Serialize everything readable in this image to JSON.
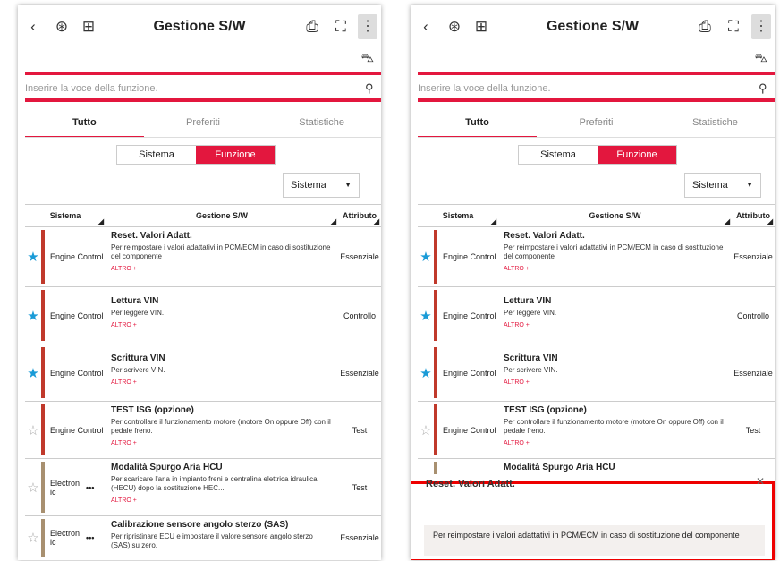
{
  "app": {
    "title": "Gestione S/W",
    "search_placeholder": "Inserire la voce della funzione.",
    "tabs": [
      "Tutto",
      "Preferiti",
      "Statistiche"
    ],
    "segment": [
      "Sistema",
      "Funzione"
    ],
    "sort_select": "Sistema",
    "columns": [
      "Sistema",
      "Gestione S/W",
      "Attributo"
    ],
    "more_label": "ALTRO +",
    "accent_color": "#e3173e",
    "favorite_color": "#1a9bd7"
  },
  "rows": [
    {
      "favorite": true,
      "system": "Engine Control",
      "title": "Reset. Valori Adatt.",
      "desc": "Per reimpostare i valori adattativi in PCM/ECM in caso di sostituzione del componente",
      "attr": "Essenziale"
    },
    {
      "favorite": true,
      "system": "Engine Control",
      "title": "Lettura VIN",
      "desc": "Per leggere VIN.",
      "attr": "Controllo"
    },
    {
      "favorite": true,
      "system": "Engine Control",
      "title": "Scrittura VIN",
      "desc": "Per scrivere VIN.",
      "attr": "Essenziale"
    },
    {
      "favorite": false,
      "system": "Engine Control",
      "title": "TEST ISG (opzione)",
      "desc": "Per controllare il funzionamento motore (motore On oppure Off) con il pedale freno.",
      "attr": "Test"
    },
    {
      "favorite": false,
      "system": "Electron ic",
      "title": "Modalità Spurgo Aria HCU",
      "desc": "Per scaricare l'aria in impianto freni e centralina elettrica idraulica (HECU) dopo la sostituzione HEC...",
      "attr": "Test"
    },
    {
      "favorite": false,
      "system": "Electron ic",
      "title": "Calibrazione sensore angolo sterzo (SAS)",
      "desc": "Per ripristinare ECU e impostare il valore sensore angolo sterzo (SAS) su zero.",
      "attr": "Essenziale"
    }
  ],
  "popup": {
    "title": "Reset. Valori Adatt.",
    "body": "Per reimpostare i valori adattativi in PCM/ECM in caso di sostituzione del componente"
  }
}
